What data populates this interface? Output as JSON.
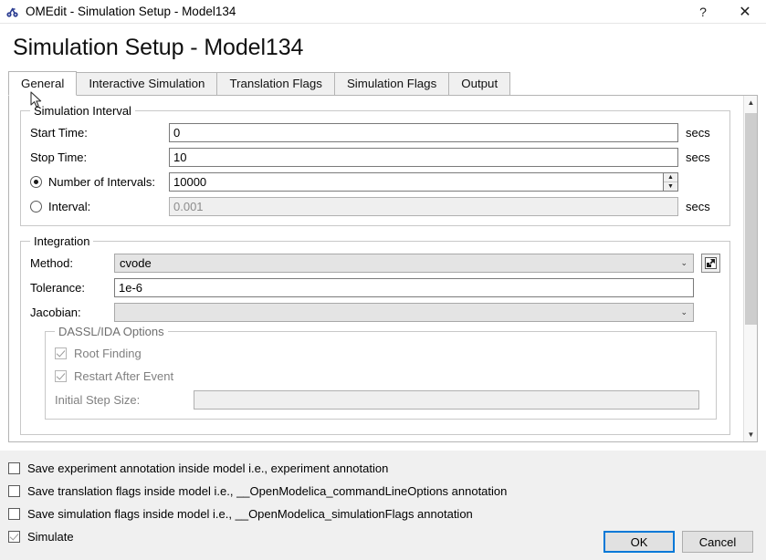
{
  "window": {
    "app_icon": "omedit-icon",
    "title": "OMEdit - Simulation Setup - Model134",
    "help_label": "?",
    "close_label": "✕"
  },
  "heading": "Simulation Setup - Model134",
  "tabs": [
    {
      "label": "General",
      "active": true
    },
    {
      "label": "Interactive Simulation",
      "active": false
    },
    {
      "label": "Translation Flags",
      "active": false
    },
    {
      "label": "Simulation Flags",
      "active": false
    },
    {
      "label": "Output",
      "active": false
    }
  ],
  "simulation_interval": {
    "group_title": "Simulation Interval",
    "start_time": {
      "label": "Start Time:",
      "value": "0",
      "unit": "secs"
    },
    "stop_time": {
      "label": "Stop Time:",
      "value": "10",
      "unit": "secs"
    },
    "number_of_intervals": {
      "label": "Number of Intervals:",
      "value": "10000",
      "selected": true,
      "spin_up": "▲",
      "spin_down": "▼"
    },
    "interval": {
      "label": "Interval:",
      "value": "0.001",
      "unit": "secs",
      "selected": false,
      "disabled": true
    }
  },
  "integration": {
    "group_title": "Integration",
    "method": {
      "label": "Method:",
      "value": "cvode",
      "arrow": "⌄"
    },
    "tolerance": {
      "label": "Tolerance:",
      "value": "1e-6"
    },
    "jacobian": {
      "label": "Jacobian:",
      "value": "",
      "arrow": "⌄"
    },
    "external_button_icon": "open-external-icon",
    "dassl_ida": {
      "group_title": "DASSL/IDA Options",
      "root_finding": {
        "label": "Root Finding",
        "checked": true,
        "disabled": true
      },
      "restart_after_event": {
        "label": "Restart After Event",
        "checked": true,
        "disabled": true
      },
      "initial_step_size": {
        "label": "Initial Step Size:",
        "value": "",
        "disabled": true
      }
    }
  },
  "scrollbar": {
    "up_arrow": "▲",
    "down_arrow": "▼"
  },
  "footer_options": [
    {
      "label": "Save experiment annotation inside model i.e., experiment annotation",
      "checked": false
    },
    {
      "label": "Save translation flags inside model i.e., __OpenModelica_commandLineOptions annotation",
      "checked": false
    },
    {
      "label": "Save simulation flags inside model i.e., __OpenModelica_simulationFlags annotation",
      "checked": false
    },
    {
      "label": "Simulate",
      "checked": true
    }
  ],
  "buttons": {
    "ok": "OK",
    "cancel": "Cancel"
  },
  "colors": {
    "accent": "#0078d7",
    "window_bg": "#f0f0f0",
    "content_bg": "#ffffff",
    "border": "#b4b4b4",
    "disabled_text": "#808080"
  }
}
